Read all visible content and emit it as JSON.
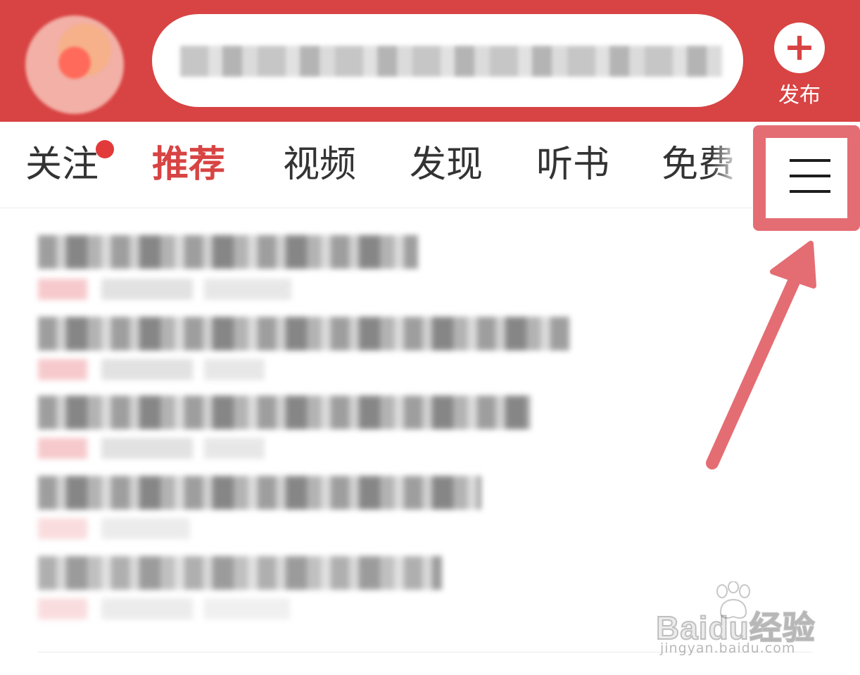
{
  "header": {
    "publish_label": "发布",
    "publish_icon": "plus-icon"
  },
  "tabs": [
    {
      "label": "关注",
      "has_dot": true
    },
    {
      "label": "推荐",
      "active": true
    },
    {
      "label": "视频"
    },
    {
      "label": "发现"
    },
    {
      "label": "听书"
    },
    {
      "label": "免费"
    }
  ],
  "menu": {
    "icon": "hamburger-menu-icon"
  },
  "watermark": {
    "brand": "Baidu经验",
    "url": "jingyan.baidu.com"
  },
  "colors": {
    "header_red": "#d84343",
    "active_tab": "#d84343",
    "highlight": "#e46d73",
    "notification_dot": "#e23a3a"
  }
}
